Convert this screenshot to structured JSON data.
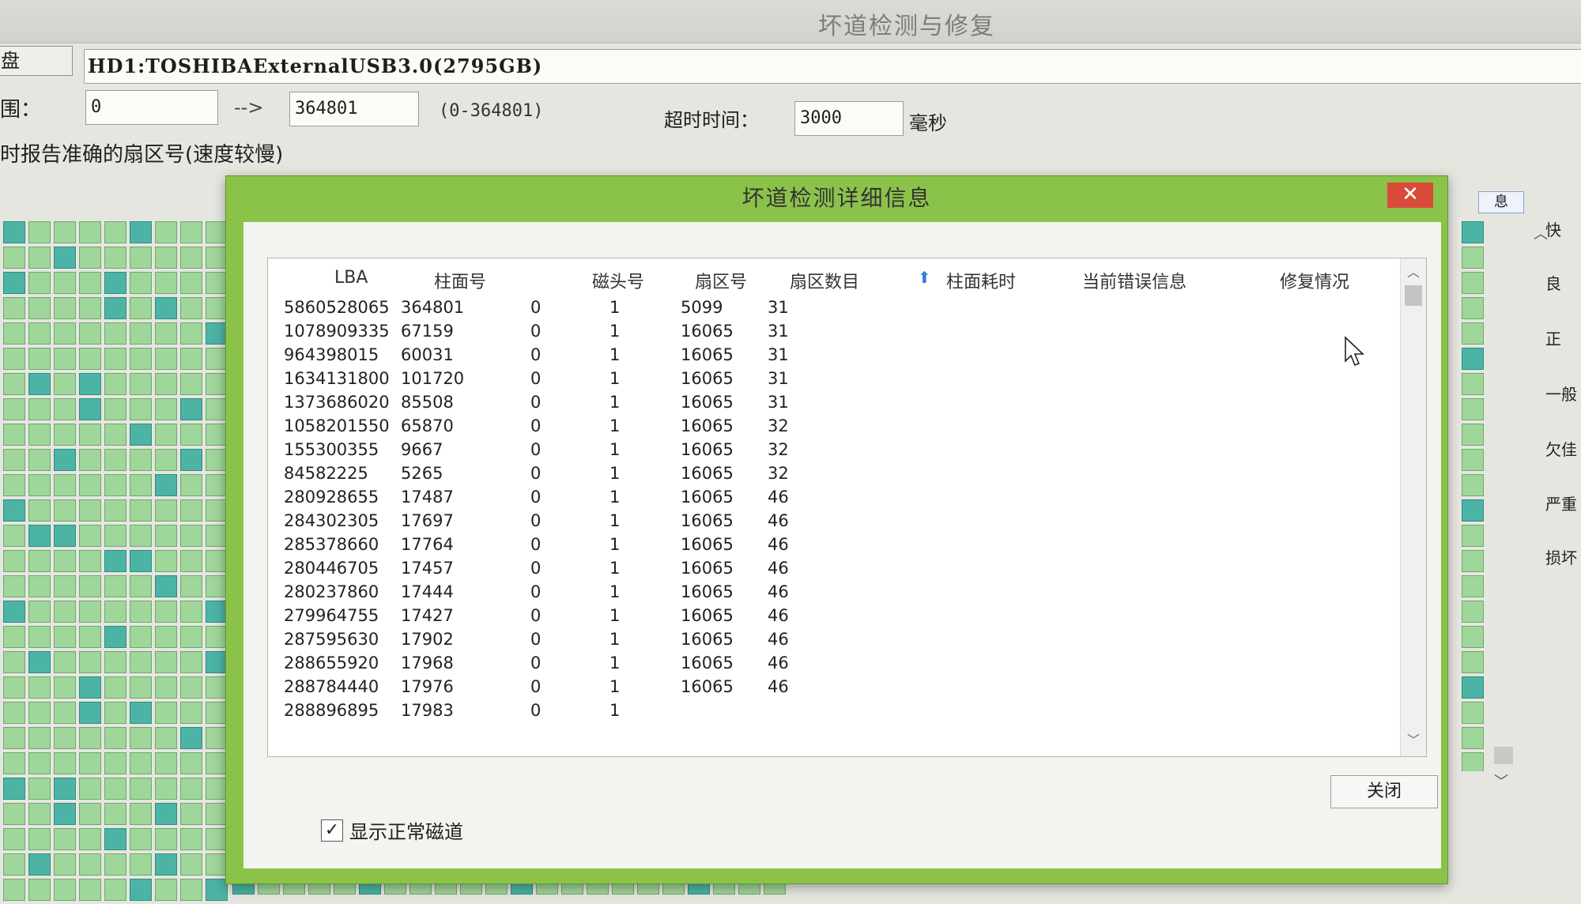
{
  "main": {
    "title": "坏道检测与修复",
    "disk_label": "盘",
    "disk_value": "HD1:TOSHIBAExternalUSB3.0(2795GB)",
    "range_label": "围：",
    "range_start": "0",
    "range_arrow": "-->",
    "range_end": "364801",
    "range_hint": "(0-364801)",
    "timeout_label": "超时时间：",
    "timeout_value": "3000",
    "timeout_unit": "毫秒",
    "report_option": "时报告准确的扇区号(速度较慢)",
    "side_tab": "息",
    "legend": [
      "快",
      "良",
      "正",
      "一般",
      "欠佳",
      "严重",
      "损坏"
    ]
  },
  "dialog": {
    "title": "坏道检测详细信息",
    "close_x": "✕",
    "columns": [
      "LBA",
      "柱面号",
      "磁头号",
      "扇区号",
      "扇区数目",
      "柱面耗时",
      "当前错误信息",
      "修复情况"
    ],
    "rows": [
      [
        "5860528065",
        "364801",
        "0",
        "1",
        "5099",
        "31"
      ],
      [
        "1078909335",
        "67159",
        "0",
        "1",
        "16065",
        "31"
      ],
      [
        "964398015",
        "60031",
        "0",
        "1",
        "16065",
        "31"
      ],
      [
        "1634131800",
        "101720",
        "0",
        "1",
        "16065",
        "31"
      ],
      [
        "1373686020",
        "85508",
        "0",
        "1",
        "16065",
        "31"
      ],
      [
        "1058201550",
        "65870",
        "0",
        "1",
        "16065",
        "32"
      ],
      [
        "155300355",
        "9667",
        "0",
        "1",
        "16065",
        "32"
      ],
      [
        "84582225",
        "5265",
        "0",
        "1",
        "16065",
        "32"
      ],
      [
        "280928655",
        "17487",
        "0",
        "1",
        "16065",
        "46"
      ],
      [
        "284302305",
        "17697",
        "0",
        "1",
        "16065",
        "46"
      ],
      [
        "285378660",
        "17764",
        "0",
        "1",
        "16065",
        "46"
      ],
      [
        "280446705",
        "17457",
        "0",
        "1",
        "16065",
        "46"
      ],
      [
        "280237860",
        "17444",
        "0",
        "1",
        "16065",
        "46"
      ],
      [
        "279964755",
        "17427",
        "0",
        "1",
        "16065",
        "46"
      ],
      [
        "287595630",
        "17902",
        "0",
        "1",
        "16065",
        "46"
      ],
      [
        "288655920",
        "17968",
        "0",
        "1",
        "16065",
        "46"
      ],
      [
        "288784440",
        "17976",
        "0",
        "1",
        "16065",
        "46"
      ],
      [
        "288896895",
        "17983",
        "0",
        "1",
        "",
        ""
      ]
    ],
    "close_button": "关闭",
    "show_normal_label": "显示正常磁道",
    "show_normal_checked": true
  },
  "colors": {
    "dialog_border": "#8bc34a",
    "close_red": "#d94a38",
    "cell_green": "#9fd69a",
    "cell_teal": "#4cb4a5"
  }
}
